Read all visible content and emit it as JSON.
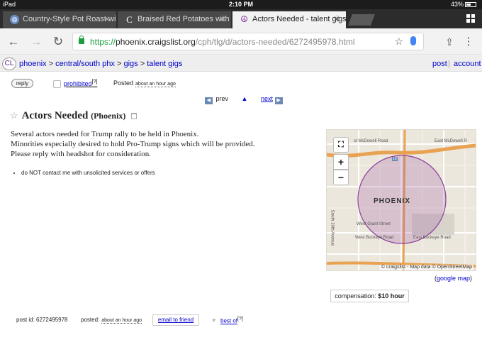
{
  "status_bar": {
    "device": "iPad",
    "time": "2:10 PM",
    "battery": "43%"
  },
  "tabs": [
    {
      "title": "Country-Style Pot Roast with",
      "favicon": "globe-icon"
    },
    {
      "title": "Braised Red Potatoes with L",
      "favicon": "c-logo-icon"
    },
    {
      "title": "Actors Needed - talent gigs",
      "favicon": "peace-icon"
    }
  ],
  "omnibox": {
    "scheme": "https://",
    "host": "phoenix.craigslist.org",
    "path": "/cph/tlg/d/actors-needed/6272495978.html"
  },
  "breadcrumb": {
    "logo": "CL",
    "items": [
      "phoenix",
      "central/south phx",
      "gigs",
      "talent gigs"
    ],
    "separator": ">",
    "post": "post",
    "account": "account"
  },
  "actions": {
    "reply": "reply",
    "prohibited": "prohibited",
    "prohibited_sup": "[?]",
    "posted_label": "Posted",
    "posted_time": "about an hour ago"
  },
  "nav": {
    "prev": "prev",
    "up": "▲",
    "next": "next"
  },
  "posting": {
    "title": "Actors Needed",
    "area": "(Phoenix)",
    "body": [
      "Several actors needed for Trump rally to be held in Phoenix.",
      "Minorities especially desired to hold Pro-Trump signs which will be provided.",
      "Please reply with headshot for consideration."
    ],
    "notices": [
      "do NOT contact me with unsolicited services or offers"
    ]
  },
  "map": {
    "labels": {
      "mcdowell_left": "st McDowell Road",
      "mcdowell_right": "East McDowell R",
      "city": "PHOENIX",
      "grant": "West Grant Street",
      "buckeye_west": "West Buckeye Road",
      "buckeye_east": "East Buckeye Road",
      "nineteenth": "South 19th Avenue",
      "interstate": "10"
    },
    "attribution": "© craigslist - Map data © OpenStreetMap",
    "google_link": "google map",
    "controls": {
      "fullscreen": "⛶",
      "zoom_in": "+",
      "zoom_out": "−"
    }
  },
  "compensation": {
    "label": "compensation:",
    "value": "$10 hour"
  },
  "footer": {
    "post_id": "post id: 6272495978",
    "posted_label": "posted:",
    "posted_time": "about an hour ago",
    "email": "email to friend",
    "best_of": "best of",
    "best_of_sup": "[?]"
  }
}
